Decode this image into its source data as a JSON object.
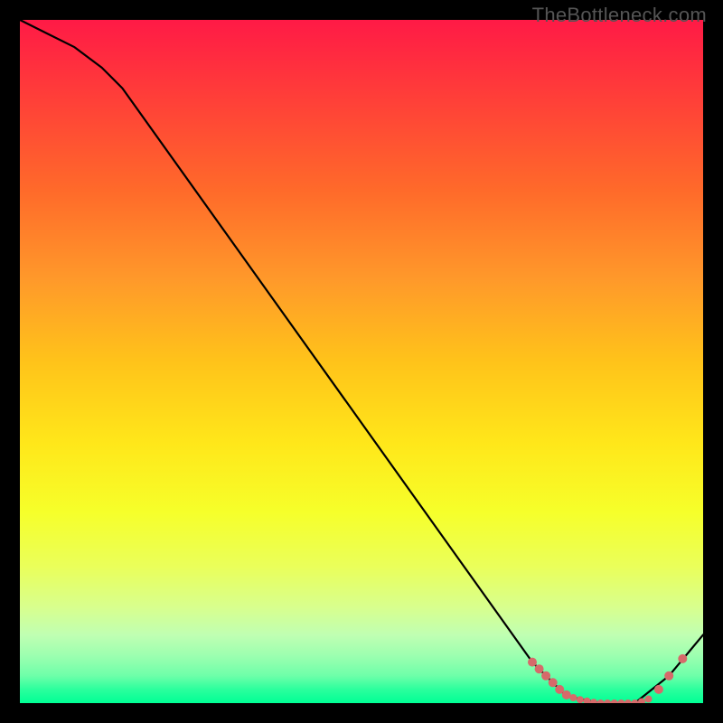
{
  "watermark": "TheBottleneck.com",
  "chart_data": {
    "type": "line",
    "title": "",
    "xlabel": "",
    "ylabel": "",
    "xlim": [
      0,
      100
    ],
    "ylim": [
      0,
      100
    ],
    "grid": false,
    "series": [
      {
        "name": "bottleneck-curve",
        "x": [
          0,
          4,
          8,
          12,
          15,
          75,
          80,
          85,
          90,
          95,
          100
        ],
        "y": [
          100,
          98,
          96,
          93,
          90,
          6,
          1,
          0,
          0,
          4,
          10
        ]
      }
    ],
    "markers": {
      "name": "highlight-points",
      "points": [
        {
          "x": 75,
          "y": 6,
          "r": 5
        },
        {
          "x": 76,
          "y": 5,
          "r": 5
        },
        {
          "x": 77,
          "y": 4,
          "r": 5
        },
        {
          "x": 78,
          "y": 3,
          "r": 5
        },
        {
          "x": 79,
          "y": 2,
          "r": 5
        },
        {
          "x": 80,
          "y": 1.2,
          "r": 5
        },
        {
          "x": 81,
          "y": 0.8,
          "r": 4
        },
        {
          "x": 82,
          "y": 0.5,
          "r": 4
        },
        {
          "x": 83,
          "y": 0.3,
          "r": 4
        },
        {
          "x": 84,
          "y": 0.1,
          "r": 4
        },
        {
          "x": 85,
          "y": 0,
          "r": 4
        },
        {
          "x": 86,
          "y": 0,
          "r": 4
        },
        {
          "x": 87,
          "y": 0,
          "r": 4
        },
        {
          "x": 88,
          "y": 0,
          "r": 4
        },
        {
          "x": 89,
          "y": 0,
          "r": 4
        },
        {
          "x": 90,
          "y": 0,
          "r": 4
        },
        {
          "x": 91,
          "y": 0.2,
          "r": 4
        },
        {
          "x": 92,
          "y": 0.6,
          "r": 4
        },
        {
          "x": 93.5,
          "y": 2,
          "r": 5
        },
        {
          "x": 95,
          "y": 4,
          "r": 5
        },
        {
          "x": 97,
          "y": 6.5,
          "r": 5
        }
      ]
    },
    "background_gradient": {
      "top": "#ff1a46",
      "mid": "#ffe71a",
      "bottom": "#00ff95"
    }
  }
}
